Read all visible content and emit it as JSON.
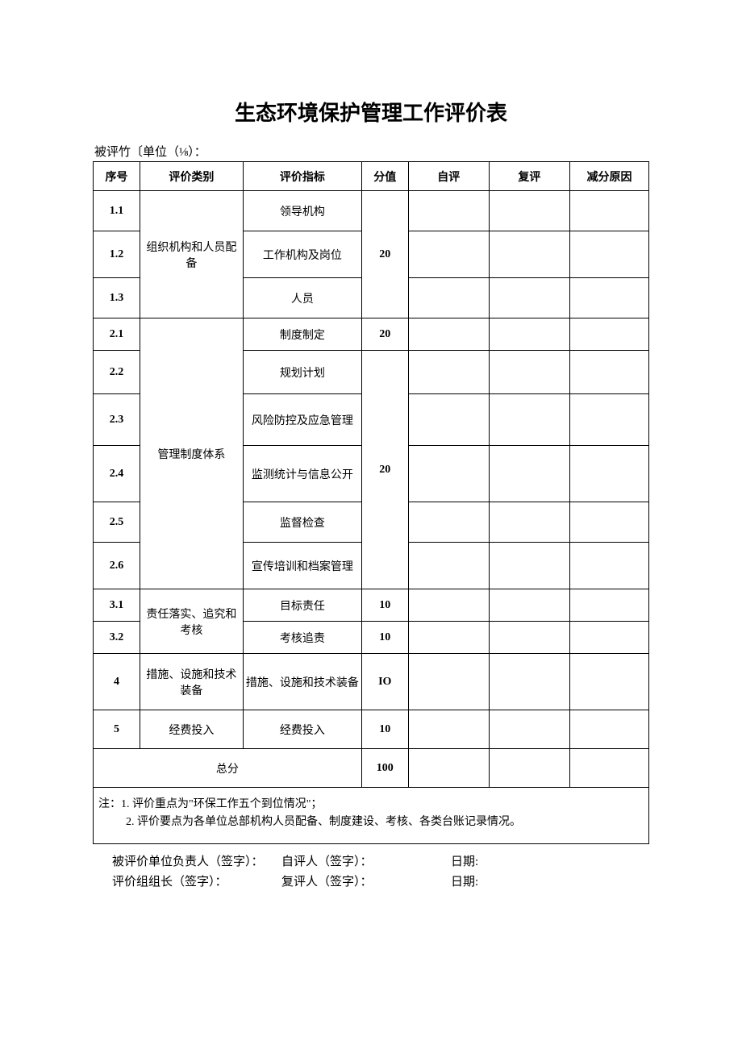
{
  "title": "生态环境保护管理工作评价表",
  "subtitle": "被评竹〔单位（⅛）：",
  "headers": {
    "seq": "序号",
    "category": "评价类别",
    "indicator": "评价指标",
    "score": "分值",
    "self": "自评",
    "review": "复评",
    "reason": "减分原因"
  },
  "rows": {
    "r1_1_seq": "1.1",
    "r1_cat": "组织机构和人员配备",
    "r1_1_ind": "领导机构",
    "r1_score": "20",
    "r1_2_seq": "1.2",
    "r1_2_ind": "工作机构及岗位",
    "r1_3_seq": "1.3",
    "r1_3_ind": "人员",
    "r2_1_seq": "2.1",
    "r2_cat": "管理制度体系",
    "r2_1_ind": "制度制定",
    "r2_1_score": "20",
    "r2_2_seq": "2.2",
    "r2_2_ind": "规划计划",
    "r2_rest_score": "20",
    "r2_3_seq": "2.3",
    "r2_3_ind": "风险防控及应急管理",
    "r2_4_seq": "2.4",
    "r2_4_ind": "监测统计与信息公开",
    "r2_5_seq": "2.5",
    "r2_5_ind": "监督检查",
    "r2_6_seq": "2.6",
    "r2_6_ind": "宣传培训和档案管理",
    "r3_1_seq": "3.1",
    "r3_cat": "责任落实、追究和考核",
    "r3_1_ind": "目标责任",
    "r3_1_score": "10",
    "r3_2_seq": "3.2",
    "r3_2_ind": "考核追责",
    "r3_2_score": "10",
    "r4_seq": "4",
    "r4_cat": "措施、设施和技术装备",
    "r4_ind": "措施、设施和技术装备",
    "r4_score": "IO",
    "r5_seq": "5",
    "r5_cat": "经费投入",
    "r5_ind": "经费投入",
    "r5_score": "10",
    "total_label": "总分",
    "total_score": "100"
  },
  "notes": {
    "n1": "注：1. 评价重点为\"环保工作五个到位情况\"；",
    "n2": "2. 评价要点为各单位总部机构人员配备、制度建设、考核、各类台账记录情况。"
  },
  "signatures": {
    "row1_a": "被评价单位负责人（签字）：",
    "row1_b": "自评人（签字）：",
    "row1_c": "日期:",
    "row2_a": "评价组组长（签字）：",
    "row2_b": "复评人（签字）：",
    "row2_c": "日期:"
  }
}
